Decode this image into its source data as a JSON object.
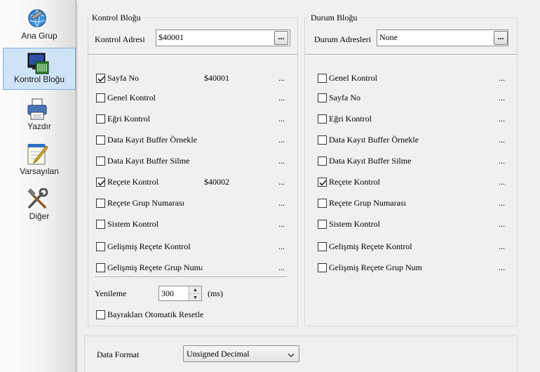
{
  "sidebar": {
    "items": [
      {
        "label": "Ana Grup",
        "icon": "globe-wrench-icon"
      },
      {
        "label": "Kontrol Bloğu",
        "icon": "monitor-keyboard-icon"
      },
      {
        "label": "Yazdır",
        "icon": "printer-icon"
      },
      {
        "label": "Varsayılan",
        "icon": "notepad-pencil-icon"
      },
      {
        "label": "Diğer",
        "icon": "tools-icon"
      }
    ],
    "active_index": 1
  },
  "kontrol": {
    "title": "Kontrol Bloğu",
    "address_label": "Kontrol Adresi",
    "address_value": "$40001",
    "browse": "...",
    "rows": [
      {
        "label": "Sayfa No",
        "checked": true,
        "value": "$40001",
        "dots": "..."
      },
      {
        "label": "Genel Kontrol",
        "checked": false,
        "value": "",
        "dots": "..."
      },
      {
        "label": "Eğri Kontrol",
        "checked": false,
        "value": "",
        "dots": "..."
      },
      {
        "label": "Data Kayıt Buffer Örnekle",
        "checked": false,
        "value": "",
        "dots": "..."
      },
      {
        "label": "Data Kayıt Buffer Silme",
        "checked": false,
        "value": "",
        "dots": "..."
      },
      {
        "label": "Reçete Kontrol",
        "checked": true,
        "value": "$40002",
        "dots": "..."
      },
      {
        "label": "Reçete Grup Numarası",
        "checked": false,
        "value": "",
        "dots": "..."
      },
      {
        "label": "Sistem Kontrol",
        "checked": false,
        "value": "",
        "dots": "..."
      },
      {
        "label": "Gelişmiş Reçete Kontrol",
        "checked": false,
        "value": "",
        "dots": "..."
      },
      {
        "label": "Gelişmiş Reçete Grup Numa",
        "checked": false,
        "value": "",
        "dots": "..."
      }
    ],
    "refresh_label": "Yenileme",
    "refresh_value": "300",
    "refresh_unit": "(ms)",
    "auto_reset_label": "Bayrakları Otomatik Resetle",
    "auto_reset_checked": false
  },
  "durum": {
    "title": "Durum Bloğu",
    "address_label": "Durum Adresleri",
    "address_value": "None",
    "browse": "...",
    "rows": [
      {
        "label": "Genel Kontrol",
        "checked": false,
        "dots": "..."
      },
      {
        "label": "Sayfa No",
        "checked": false,
        "dots": "..."
      },
      {
        "label": "Eğri Kontrol",
        "checked": false,
        "dots": "..."
      },
      {
        "label": "Data Kayıt Buffer Örnekle",
        "checked": false,
        "dots": "..."
      },
      {
        "label": "Data Kayıt Buffer Silme",
        "checked": false,
        "dots": "..."
      },
      {
        "label": "Reçete Kontrol",
        "checked": true,
        "dots": "..."
      },
      {
        "label": "Reçete Grup Numarası",
        "checked": false,
        "dots": "..."
      },
      {
        "label": "Sistem Kontrol",
        "checked": false,
        "dots": "..."
      },
      {
        "label": "Gelişmiş Reçete Kontrol",
        "checked": false,
        "dots": "..."
      },
      {
        "label": "Gelişmiş Reçete Grup Num",
        "checked": false,
        "dots": "..."
      }
    ]
  },
  "format": {
    "label": "Data Format",
    "value": "Unsigned Decimal"
  }
}
